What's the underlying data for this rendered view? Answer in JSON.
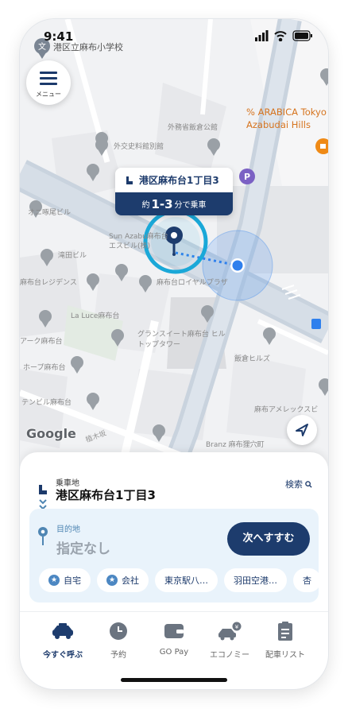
{
  "status": {
    "time": "9:41"
  },
  "menu": {
    "label": "メニュー"
  },
  "map": {
    "labels": {
      "school": "港区立麻布小学校",
      "arabica": "% ARABICA Tokyo Azabudai Hills",
      "hall": "外務省飯倉公館",
      "archive": "外交史料館別館",
      "oni": "オニ啄尾ビル",
      "yukari": "滝田ビル",
      "azabudai_residence": "麻布台レジデンス",
      "royal": "麻布台ロイヤルプラザ",
      "sunazabu": "Sun Azabu麻布台 エスビル(株)",
      "laluce": "La Luce麻布台",
      "grand": "グランスイート麻布台 ヒルトップタワー",
      "iikura": "飯倉ヒルズ",
      "ark": "アーク麻布台",
      "hope": "ホープ麻布台",
      "tateru": "テンビル麻布台",
      "amerex": "麻布アメレックスビ",
      "branz": "Branz 麻布狸穴町",
      "google": "Google",
      "road": "植木坂"
    }
  },
  "pickup_card": {
    "address": "港区麻布台1丁目3",
    "eta_prefix": "約",
    "eta_range": "1-3",
    "eta_suffix": "分で乗車"
  },
  "sheet": {
    "pickup_label": "乗車地",
    "pickup_address": "港区麻布台1丁目3",
    "search_label": "検索",
    "destination_label": "目的地",
    "destination_value": "指定なし",
    "next_button": "次へすすむ",
    "chips": [
      "自宅",
      "会社",
      "東京駅八…",
      "羽田空港…",
      "杏"
    ]
  },
  "tabs": [
    {
      "label": "今すぐ呼ぶ",
      "icon": "taxi-icon",
      "active": true
    },
    {
      "label": "予約",
      "icon": "clock-icon",
      "active": false
    },
    {
      "label": "GO Pay",
      "icon": "wallet-icon",
      "active": false
    },
    {
      "label": "エコノミー",
      "icon": "economy-car-icon",
      "active": false
    },
    {
      "label": "配車リスト",
      "icon": "clipboard-icon",
      "active": false
    }
  ],
  "colors": {
    "brand": "#1d3c6d",
    "accent": "#1aa8d8",
    "location": "#2f80ed"
  }
}
